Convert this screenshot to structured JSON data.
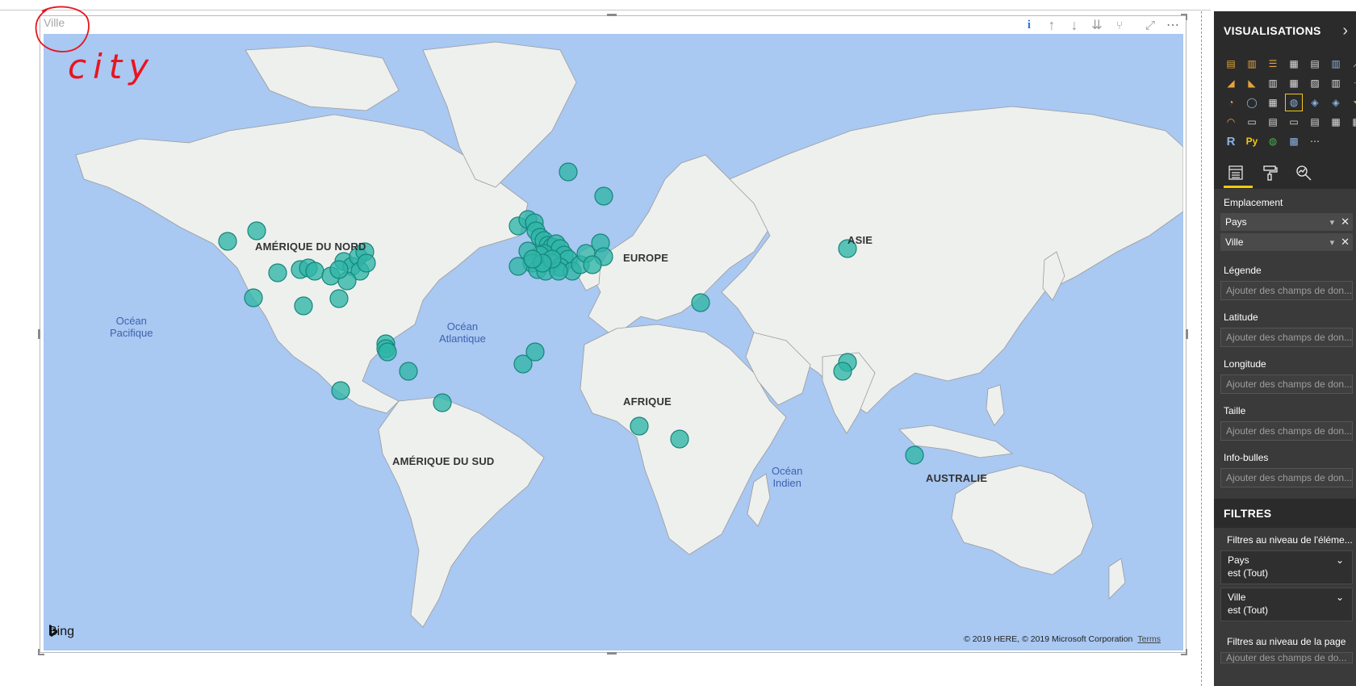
{
  "visual": {
    "title": "Ville",
    "toolbar": [
      {
        "name": "info-icon",
        "glyph": "i"
      },
      {
        "name": "drill-up-icon",
        "glyph": "↑"
      },
      {
        "name": "drill-down-icon",
        "glyph": "↓"
      },
      {
        "name": "expand-all-icon",
        "glyph": "⇊"
      },
      {
        "name": "hierarchy-icon",
        "glyph": "⑂"
      },
      {
        "name": "focus-mode-icon",
        "glyph": "⤢"
      },
      {
        "name": "more-options-icon",
        "glyph": "⋯"
      }
    ]
  },
  "annotation": {
    "text": "city",
    "color": "#e8141e"
  },
  "map": {
    "continents": {
      "north_america": "AMÉRIQUE DU NORD",
      "europe": "EUROPE",
      "asia": "ASIE",
      "africa": "AFRIQUE",
      "south_america": "AMÉRIQUE DU SUD",
      "australia": "AUSTRALIE"
    },
    "oceans": {
      "pacific_1": "Océan",
      "pacific_2": "Pacifique",
      "atlantic_1": "Océan",
      "atlantic_2": "Atlantique",
      "indian_1": "Océan",
      "indian_2": "Indien"
    },
    "bing": "Bing",
    "copyright": "© 2019 HERE, © 2019 Microsoft Corporation",
    "terms": "Terms",
    "bubble_color": "#2fb5a8",
    "ocean_color": "#a9c8f2",
    "land_color": "#eef0ee"
  },
  "pane": {
    "title": "VISUALISATIONS",
    "expand_glyph": "›",
    "viz_icons": [
      "stacked-bar-icon",
      "stacked-column-icon",
      "clustered-bar-icon",
      "clustered-column-icon",
      "100-bar-icon",
      "100-column-icon",
      "line-icon",
      "area-icon",
      "stacked-area-icon",
      "line-column-icon",
      "line-clustered-icon",
      "ribbon-icon",
      "waterfall-icon",
      "scatter-icon",
      "pie-icon",
      "donut-icon",
      "treemap-icon",
      "map-icon",
      "filled-map-icon",
      "shape-map-icon",
      "funnel-icon",
      "gauge-icon",
      "card-icon",
      "multirow-card-icon",
      "kpi-icon",
      "slicer-icon",
      "table-icon",
      "matrix-icon",
      "r-visual-icon",
      "python-visual-icon",
      "arcgis-icon",
      "globe-icon",
      "more-visuals-icon"
    ],
    "r_label": "R",
    "py_label": "Py",
    "more_label": "⋯",
    "sections": {
      "emplacement": "Emplacement",
      "legende": "Légende",
      "latitude": "Latitude",
      "longitude": "Longitude",
      "taille": "Taille",
      "infobulles": "Info-bulles"
    },
    "fields": [
      {
        "label": "Pays"
      },
      {
        "label": "Ville"
      }
    ],
    "drop_placeholder": "Ajouter des champs de don...",
    "filters": {
      "title": "FILTRES",
      "visual_level": "Filtres au niveau de l'éléme...",
      "cards": [
        {
          "field": "Pays",
          "state": "est (Tout)"
        },
        {
          "field": "Ville",
          "state": "est (Tout)"
        }
      ],
      "page_level": "Filtres au niveau de la page",
      "page_drop": "Ajouter des champs de do..."
    }
  }
}
